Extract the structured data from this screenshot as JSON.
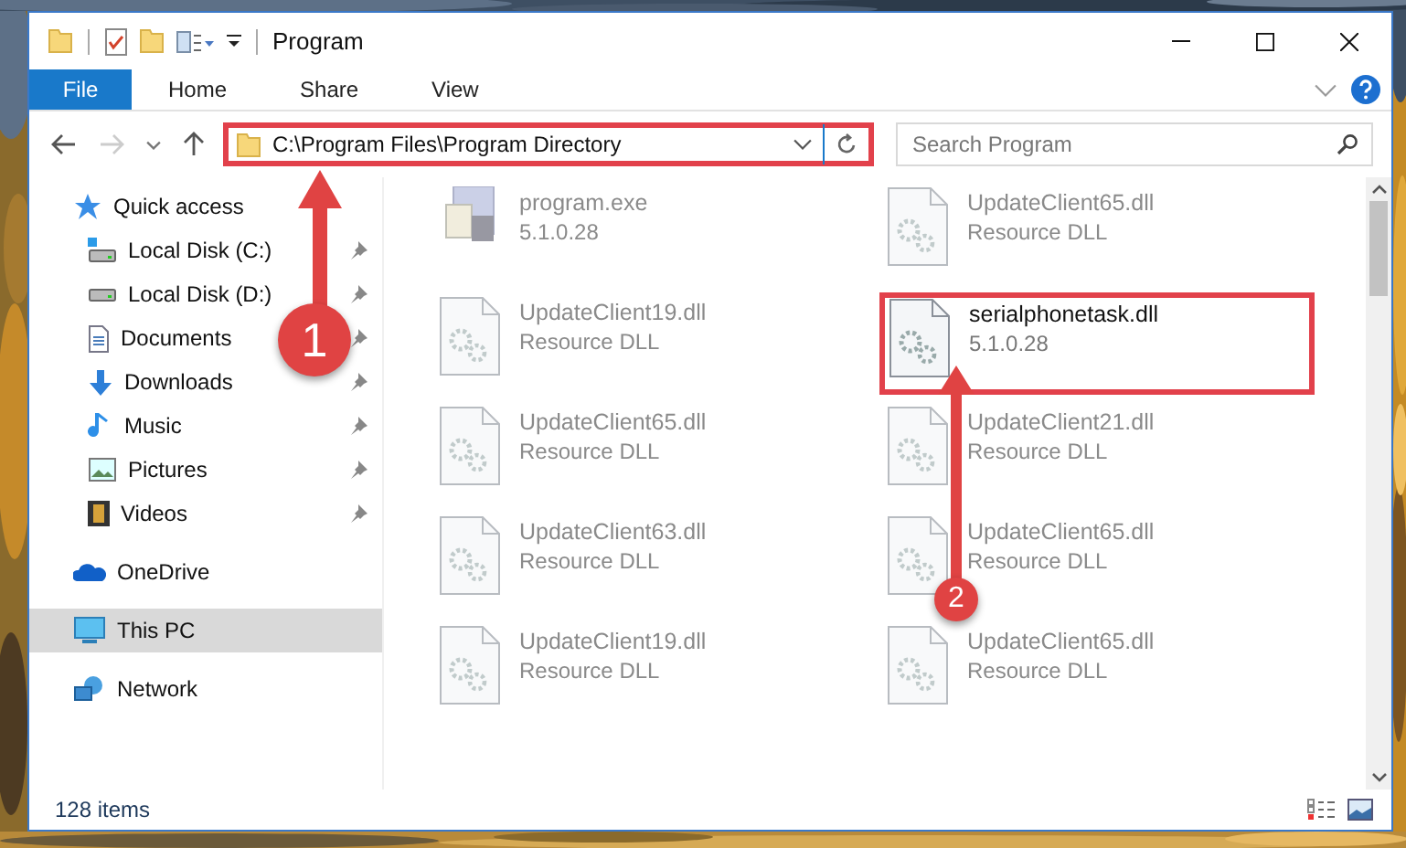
{
  "window": {
    "title": "Program"
  },
  "ribbon_tabs": [
    {
      "label": "File",
      "selected": true
    },
    {
      "label": "Home",
      "selected": false
    },
    {
      "label": "Share",
      "selected": false
    },
    {
      "label": "View",
      "selected": false
    }
  ],
  "address": {
    "value": "C:\\Program Files\\Program Directory",
    "outlined": true
  },
  "search": {
    "placeholder": "Search Program"
  },
  "sidebar": {
    "items": [
      {
        "label": "Quick access",
        "selected": false,
        "children": [
          {
            "label": "Local Disk (C:)",
            "pinned": true,
            "selected": false
          },
          {
            "label": "Local Disk (D:)",
            "pinned": true,
            "selected": false
          },
          {
            "label": "Documents",
            "pinned": true,
            "selected": false
          },
          {
            "label": "Downloads",
            "pinned": true,
            "selected": false
          },
          {
            "label": "Music",
            "pinned": true,
            "selected": false
          },
          {
            "label": "Pictures",
            "pinned": true,
            "selected": false
          },
          {
            "label": "Videos",
            "pinned": true,
            "selected": false
          }
        ]
      },
      {
        "label": "OneDrive",
        "selected": false
      },
      {
        "label": "This PC",
        "selected": true
      },
      {
        "label": "Network",
        "selected": false
      }
    ]
  },
  "files": [
    {
      "kind": "exe",
      "name": "program.exe",
      "detail": "5.1.0.28",
      "blurred": true,
      "outlined": false
    },
    {
      "kind": "dll",
      "name": "UpdateClient65.dll",
      "detail": "Resource DLL",
      "blurred": true,
      "outlined": false
    },
    {
      "kind": "dll",
      "name": "UpdateClient19.dll",
      "detail": "Resource DLL",
      "blurred": true,
      "outlined": false
    },
    {
      "kind": "dll",
      "name": "serialphonetask.dll",
      "detail": "5.1.0.28",
      "blurred": false,
      "outlined": true
    },
    {
      "kind": "dll",
      "name": "UpdateClient65.dll",
      "detail": "Resource DLL",
      "blurred": true,
      "outlined": false
    },
    {
      "kind": "dll",
      "name": "UpdateClient21.dll",
      "detail": "Resource DLL",
      "blurred": true,
      "outlined": false
    },
    {
      "kind": "dll",
      "name": "UpdateClient63.dll",
      "detail": "Resource DLL",
      "blurred": true,
      "outlined": false
    },
    {
      "kind": "dll",
      "name": "UpdateClient65.dll",
      "detail": "Resource DLL",
      "blurred": true,
      "outlined": false
    },
    {
      "kind": "dll",
      "name": "UpdateClient19.dll",
      "detail": "Resource DLL",
      "blurred": true,
      "outlined": false
    },
    {
      "kind": "dll",
      "name": "UpdateClient65.dll",
      "detail": "Resource DLL",
      "blurred": true,
      "outlined": false
    }
  ],
  "status_bar": {
    "count": "128 items"
  },
  "annotations": [
    {
      "label": "1"
    },
    {
      "label": "2"
    }
  ]
}
